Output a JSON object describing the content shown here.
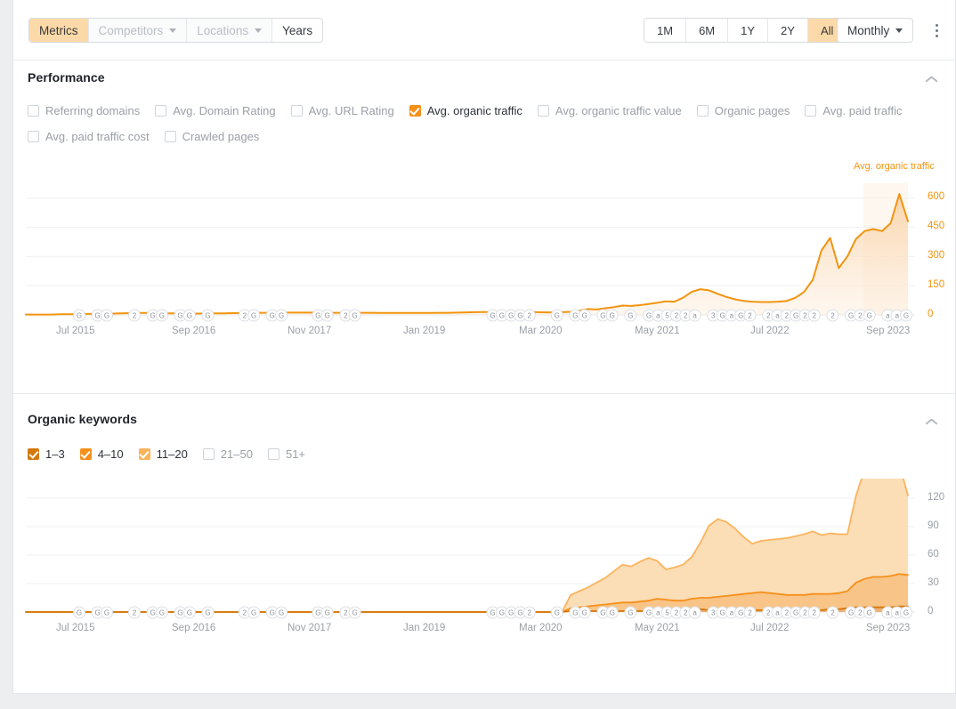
{
  "toolbar": {
    "tabs": [
      {
        "label": "Metrics",
        "state": "active",
        "caret": false
      },
      {
        "label": "Competitors",
        "state": "disabled",
        "caret": true
      },
      {
        "label": "Locations",
        "state": "disabled",
        "caret": true
      },
      {
        "label": "Years",
        "state": "normal",
        "caret": false
      }
    ],
    "ranges": [
      {
        "label": "1M",
        "state": "normal"
      },
      {
        "label": "6M",
        "state": "normal"
      },
      {
        "label": "1Y",
        "state": "normal"
      },
      {
        "label": "2Y",
        "state": "normal"
      },
      {
        "label": "All",
        "state": "active"
      }
    ],
    "granularity": "Monthly",
    "more_icon": "kebab-menu-icon"
  },
  "performance": {
    "title": "Performance",
    "collapse_icon": "chevron-up-icon",
    "metrics": [
      {
        "label": "Referring domains",
        "checked": false
      },
      {
        "label": "Avg. Domain Rating",
        "checked": false
      },
      {
        "label": "Avg. URL Rating",
        "checked": false
      },
      {
        "label": "Avg. organic traffic",
        "checked": true,
        "color": "#f5901a"
      },
      {
        "label": "Avg. organic traffic value",
        "checked": false
      },
      {
        "label": "Organic pages",
        "checked": false
      },
      {
        "label": "Avg. paid traffic",
        "checked": false
      },
      {
        "label": "Avg. paid traffic cost",
        "checked": false
      },
      {
        "label": "Crawled pages",
        "checked": false
      }
    ]
  },
  "organic_keywords": {
    "title": "Organic keywords",
    "collapse_icon": "chevron-up-icon",
    "buckets": [
      {
        "label": "1–3",
        "checked": true,
        "color": "#d4780c"
      },
      {
        "label": "4–10",
        "checked": true,
        "color": "#f5901a"
      },
      {
        "label": "11–20",
        "checked": true,
        "color": "#fbb45c"
      },
      {
        "label": "21–50",
        "checked": false,
        "color": "#cfd4d9"
      },
      {
        "label": "51+",
        "checked": false,
        "color": "#cfd4d9"
      }
    ]
  },
  "chart_data": [
    {
      "id": "performance-chart",
      "type": "area",
      "title": "Avg. organic traffic",
      "series_label": "Avg. organic traffic",
      "line_color": "#f2940f",
      "fill_color": "#fbe3c6",
      "xlabel": "",
      "ylabel": "",
      "ylim": [
        0,
        675
      ],
      "yticks": [
        0,
        150,
        300,
        450,
        600
      ],
      "ytick_color": "#f2940f",
      "grid": true,
      "xticks": [
        "Jul 2015",
        "Sep 2016",
        "Nov 2017",
        "Jan 2019",
        "Mar 2020",
        "May 2021",
        "Jul 2022",
        "Sep 2023"
      ],
      "x_start": "Jan 2015",
      "x_end": "Nov 2023",
      "values": [
        2,
        2,
        2,
        2,
        3,
        3,
        4,
        5,
        5,
        6,
        7,
        8,
        9,
        10,
        10,
        9,
        8,
        8,
        7,
        7,
        7,
        8,
        8,
        8,
        9,
        9,
        10,
        11,
        11,
        12,
        12,
        12,
        12,
        12,
        12,
        11,
        11,
        11,
        11,
        11,
        11,
        10,
        10,
        10,
        10,
        10,
        10,
        10,
        11,
        11,
        12,
        13,
        14,
        15,
        15,
        16,
        16,
        16,
        15,
        14,
        13,
        13,
        14,
        16,
        22,
        30,
        28,
        34,
        40,
        48,
        46,
        50,
        56,
        62,
        70,
        68,
        88,
        118,
        132,
        126,
        108,
        92,
        80,
        72,
        68,
        66,
        66,
        68,
        72,
        88,
        118,
        180,
        330,
        395,
        240,
        300,
        390,
        430,
        440,
        430,
        470,
        620,
        480
      ],
      "peak_value": 620,
      "last_value": 480,
      "markers_note": "Google algorithm update badges along x-axis"
    },
    {
      "id": "organic-keywords-chart",
      "type": "area",
      "stacked": true,
      "ylim": [
        0,
        135
      ],
      "yticks": [
        0,
        30,
        60,
        90,
        120
      ],
      "ytick_color": "#9aa0a7",
      "grid": true,
      "xticks": [
        "Jul 2015",
        "Sep 2016",
        "Nov 2017",
        "Jan 2019",
        "Mar 2020",
        "May 2021",
        "Jul 2022",
        "Sep 2023"
      ],
      "series": [
        {
          "name": "1–3",
          "color": "#d4780c",
          "fill": "#e8b municipal",
          "values": [
            0,
            0,
            0,
            0,
            0,
            0,
            0,
            0,
            0,
            0,
            0,
            0,
            0,
            0,
            0,
            0,
            0,
            0,
            0,
            0,
            0,
            0,
            0,
            0,
            0,
            0,
            0,
            0,
            0,
            0,
            0,
            0,
            0,
            0,
            0,
            0,
            0,
            0,
            0,
            0,
            0,
            0,
            0,
            0,
            0,
            0,
            0,
            0,
            0,
            0,
            0,
            0,
            0,
            0,
            0,
            0,
            0,
            0,
            0,
            0,
            0,
            0,
            0,
            1,
            1,
            1,
            1,
            1,
            1,
            1,
            1,
            1,
            1,
            2,
            2,
            2,
            2,
            3,
            3,
            2,
            2,
            2,
            2,
            2,
            2,
            2,
            2,
            2,
            2,
            2,
            2,
            2,
            2,
            3,
            3,
            4,
            5,
            5,
            5,
            5,
            5,
            6,
            6
          ]
        },
        {
          "name": "4–10",
          "color": "#f5901a",
          "values": [
            0,
            0,
            0,
            0,
            0,
            0,
            0,
            0,
            0,
            0,
            0,
            0,
            0,
            0,
            0,
            0,
            0,
            0,
            0,
            0,
            0,
            0,
            0,
            0,
            0,
            0,
            0,
            0,
            0,
            0,
            0,
            0,
            0,
            0,
            0,
            0,
            0,
            0,
            0,
            0,
            0,
            0,
            0,
            0,
            0,
            0,
            0,
            0,
            0,
            0,
            0,
            0,
            0,
            0,
            0,
            0,
            0,
            0,
            0,
            0,
            0,
            0,
            0,
            3,
            4,
            5,
            6,
            7,
            8,
            9,
            9,
            10,
            11,
            12,
            11,
            10,
            10,
            11,
            12,
            13,
            14,
            15,
            16,
            17,
            18,
            19,
            18,
            17,
            16,
            16,
            16,
            17,
            17,
            16,
            17,
            18,
            26,
            30,
            32,
            32,
            33,
            34,
            33
          ]
        },
        {
          "name": "11–20",
          "color": "#fbb45c",
          "values": [
            0,
            0,
            0,
            0,
            0,
            0,
            0,
            0,
            0,
            0,
            0,
            0,
            0,
            0,
            0,
            0,
            0,
            0,
            0,
            0,
            0,
            0,
            0,
            0,
            0,
            0,
            0,
            0,
            0,
            0,
            0,
            0,
            0,
            0,
            0,
            0,
            0,
            0,
            0,
            0,
            0,
            0,
            0,
            0,
            0,
            0,
            0,
            0,
            0,
            0,
            0,
            0,
            0,
            0,
            0,
            0,
            0,
            0,
            0,
            0,
            0,
            0,
            0,
            14,
            17,
            20,
            24,
            28,
            34,
            40,
            38,
            42,
            45,
            40,
            32,
            35,
            38,
            44,
            58,
            76,
            82,
            78,
            70,
            60,
            52,
            54,
            56,
            58,
            60,
            62,
            64,
            66,
            62,
            64,
            62,
            60,
            92,
            115,
            118,
            118,
            117,
            116,
            84
          ]
        }
      ]
    }
  ]
}
